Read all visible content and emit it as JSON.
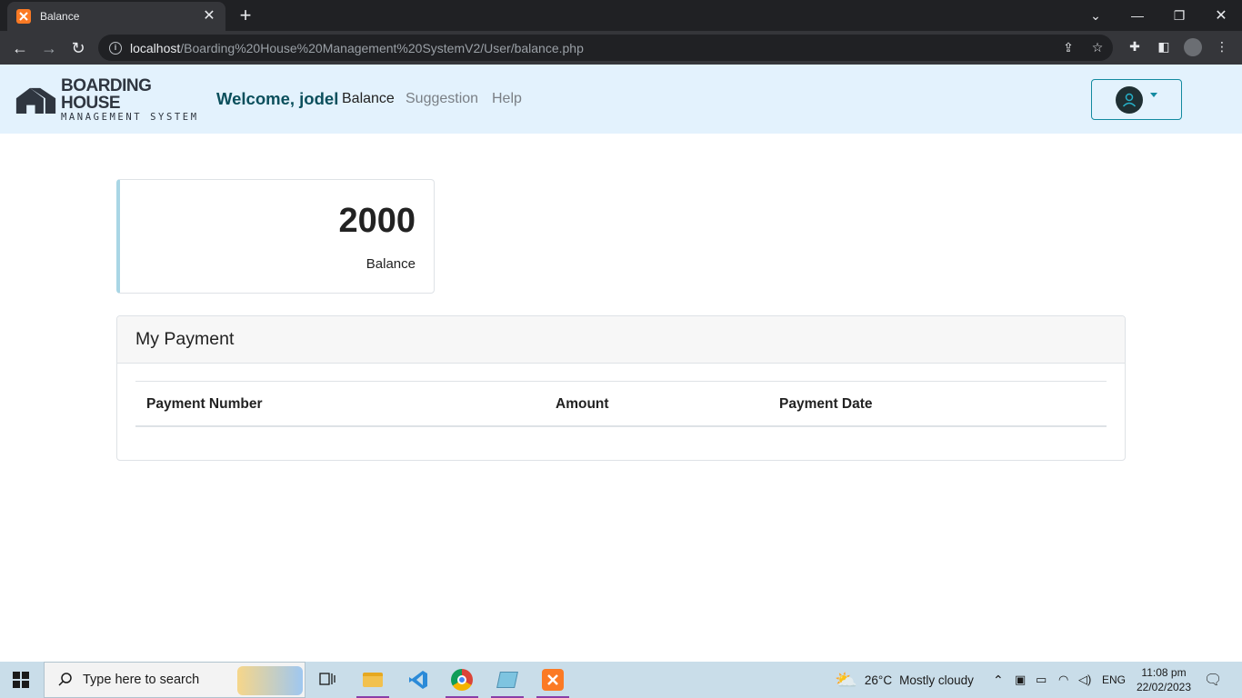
{
  "browser": {
    "tab_title": "Balance",
    "new_tab": "+",
    "url_host": "localhost",
    "url_path": "/Boarding%20House%20Management%20SystemV2/User/balance.php"
  },
  "navbar": {
    "logo_line1": "BOARDING HOUSE",
    "logo_line2": "MANAGEMENT SYSTEM",
    "welcome": "Welcome, jodel",
    "links": [
      {
        "label": "Balance",
        "active": true
      },
      {
        "label": "Suggestion",
        "active": false
      },
      {
        "label": "Help",
        "active": false
      }
    ]
  },
  "balance": {
    "value": "2000",
    "label": "Balance"
  },
  "payments": {
    "title": "My Payment",
    "columns": [
      "Payment Number",
      "Amount",
      "Payment Date"
    ],
    "rows": []
  },
  "taskbar": {
    "search_placeholder": "Type here to search",
    "weather_temp": "26°C",
    "weather_text": "Mostly cloudy",
    "language": "ENG",
    "time": "11:08 pm",
    "date": "22/02/2023"
  },
  "colors": {
    "navbar_bg": "#e3f2fd",
    "welcome": "#0b4f5c",
    "accent": "#128aa0",
    "card_border_left": "#a9d6e5"
  }
}
